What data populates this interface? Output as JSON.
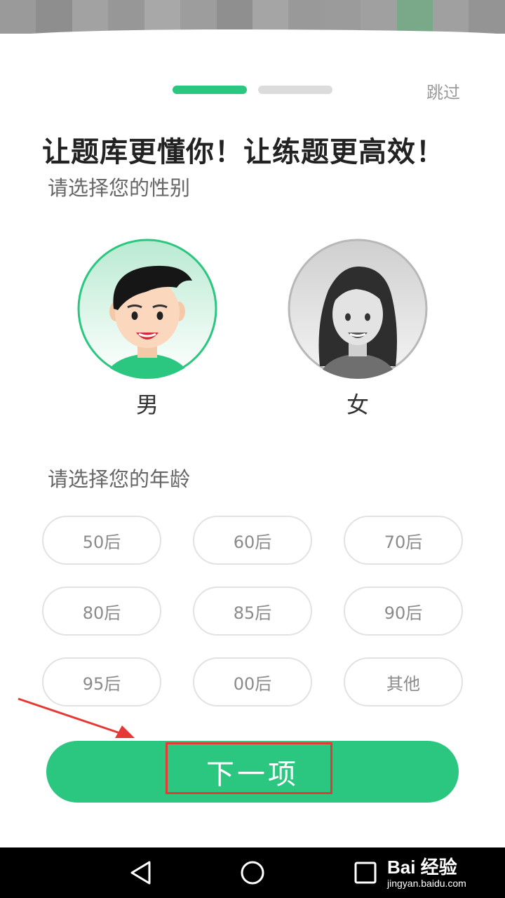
{
  "onboarding": {
    "skip_label": "跳过",
    "headline": "让题库更懂你！让练题更高效！",
    "gender_prompt": "请选择您的性别",
    "gender_options": [
      {
        "label": "男",
        "selected": true
      },
      {
        "label": "女",
        "selected": false
      }
    ],
    "age_prompt": "请选择您的年龄",
    "age_options": [
      "50后",
      "60后",
      "70后",
      "80后",
      "85后",
      "90后",
      "95后",
      "00后",
      "其他"
    ],
    "next_label": "下一项",
    "progress": {
      "total_steps": 2,
      "current_step": 1
    }
  },
  "watermark": {
    "main": "Bai 经验",
    "sub": "jingyan.baidu.com"
  },
  "colors": {
    "accent": "#2bc67f",
    "progress_inactive": "#dcdcdc",
    "annotation_red": "#e53935"
  }
}
